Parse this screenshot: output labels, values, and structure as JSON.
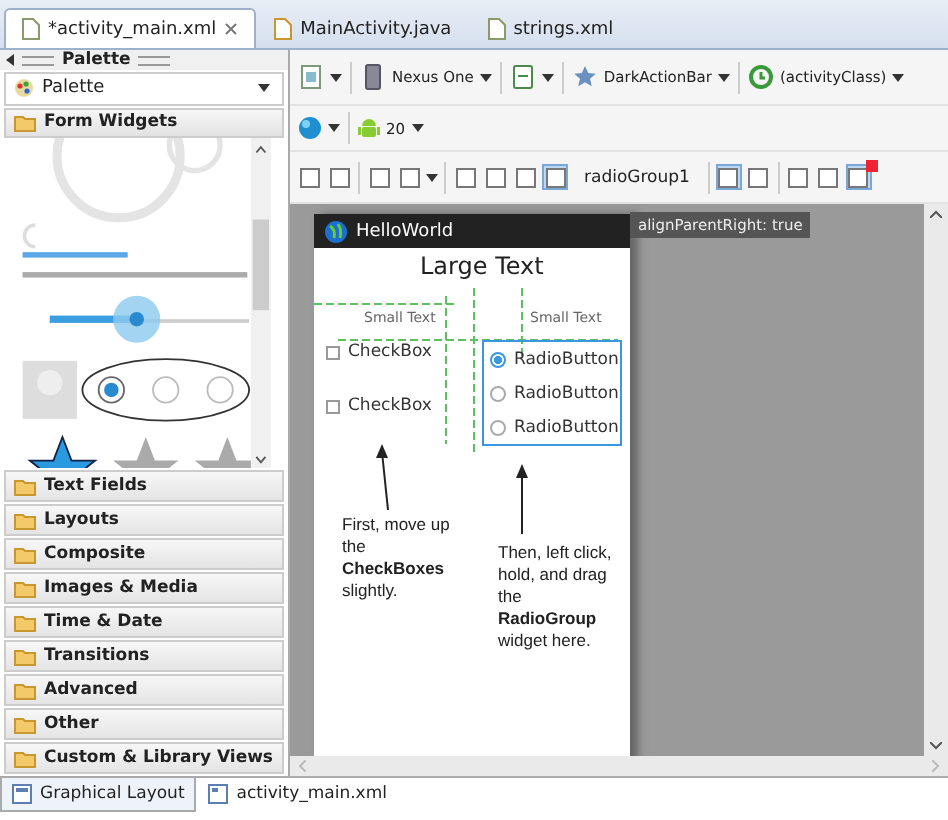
{
  "editor_tabs": [
    {
      "label": "*activity_main.xml",
      "selected": true
    },
    {
      "label": "MainActivity.java",
      "selected": false
    },
    {
      "label": "strings.xml",
      "selected": false
    }
  ],
  "palette": {
    "title": "Palette",
    "dropdown": "Palette",
    "open_section": "Form Widgets",
    "categories": [
      "Text Fields",
      "Layouts",
      "Composite",
      "Images & Media",
      "Time & Date",
      "Transitions",
      "Advanced",
      "Other",
      "Custom & Library Views"
    ]
  },
  "toolbar": {
    "device": "Nexus One",
    "theme": "DarkActionBar",
    "activity": "(activityClass)",
    "api_level": "20",
    "tool_buttons": [
      {
        "selected": false
      },
      {
        "selected": false
      },
      {
        "selected": false
      },
      {
        "selected": false
      },
      {
        "selected": false
      },
      {
        "selected": false
      },
      {
        "selected": false
      },
      {
        "selected": true
      }
    ],
    "selection": "radioGroup1",
    "view_buttons": [
      {
        "selected": true
      },
      {
        "selected": false
      }
    ],
    "size_buttons": [
      {
        "selected": false
      },
      {
        "selected": false
      },
      {
        "selected": true
      }
    ]
  },
  "canvas": {
    "app_title": "HelloWorld",
    "large_text": "Large Text",
    "small_texts": [
      "Small Text",
      "Small Text"
    ],
    "checkboxes": [
      {
        "label": "CheckBox",
        "checked": false
      },
      {
        "label": "CheckBox",
        "checked": false
      }
    ],
    "radios": [
      {
        "label": "RadioButton",
        "selected": true
      },
      {
        "label": "RadioButton",
        "selected": false
      },
      {
        "label": "RadioButton",
        "selected": false
      }
    ],
    "tooltip": "alignParentRight: true",
    "annotations": [
      "First, move up the **CheckBoxes** slightly.",
      "Then, left click, hold, and drag the **RadioGroup** widget here."
    ]
  },
  "bottom_tabs": [
    {
      "label": "Graphical Layout",
      "selected": true
    },
    {
      "label": "activity_main.xml",
      "selected": false
    }
  ]
}
